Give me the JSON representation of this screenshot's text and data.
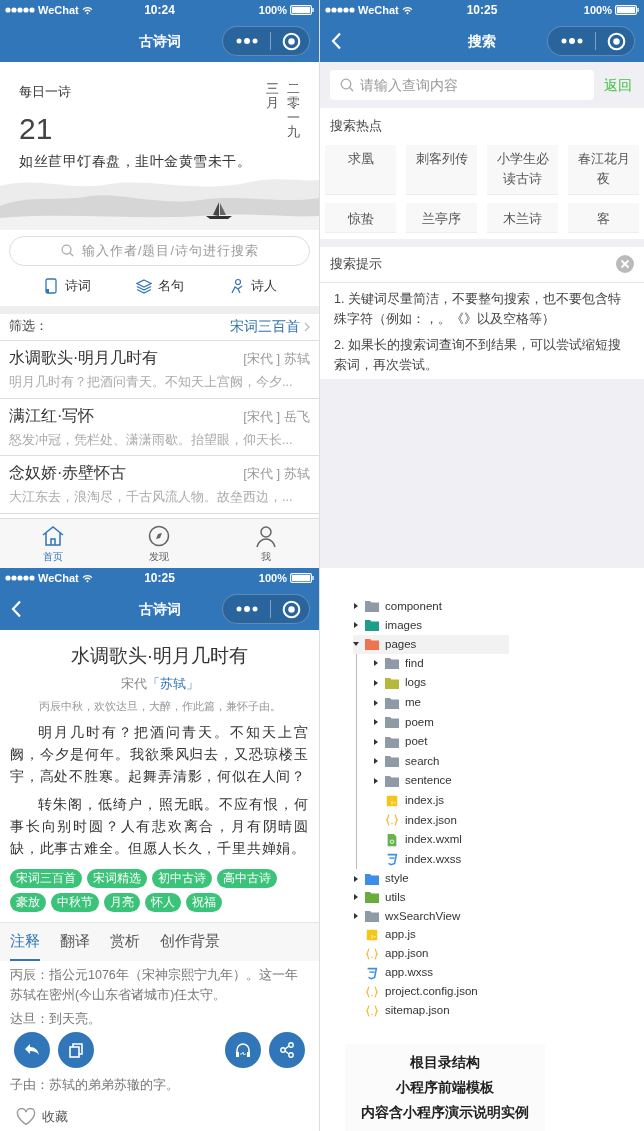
{
  "home_screen": {
    "status_bar": {
      "carrier": "WeChat",
      "time": "10:24",
      "battery": "100%"
    },
    "nav": {
      "title": "古诗词",
      "back": false
    },
    "daily": {
      "label": "每日一诗",
      "day": "21",
      "month": "三月",
      "year": "二零一九",
      "verse": "如丝苣甲饤春盘，韭叶金黄雪未干。"
    },
    "search": {
      "placeholder": "输入作者/题目/诗句进行搜索"
    },
    "categories": [
      {
        "label": "诗词",
        "kind": "poems"
      },
      {
        "label": "名句",
        "kind": "quotes"
      },
      {
        "label": "诗人",
        "kind": "poets"
      }
    ],
    "filter": {
      "label": "筛选：",
      "value": "宋词三百首"
    },
    "poems": [
      {
        "title": "水调歌头·明月几时有",
        "dynasty": "[宋代 ]",
        "author": "苏轼",
        "excerpt": "明月几时有？把酒问青天。不知天上宫阙，今夕..."
      },
      {
        "title": "满江红·写怀",
        "dynasty": "[宋代 ]",
        "author": "岳飞",
        "excerpt": "怒发冲冠，凭栏处、潇潇雨歇。抬望眼，仰天长..."
      },
      {
        "title": "念奴娇·赤壁怀古",
        "dynasty": "[宋代 ]",
        "author": "苏轼",
        "excerpt": "大江东去，浪淘尽，千古风流人物。故垒西边，..."
      }
    ],
    "tab_bar": [
      {
        "label": "首页",
        "kind": "home",
        "selected": true
      },
      {
        "label": "发现",
        "kind": "discover",
        "selected": false
      },
      {
        "label": "我",
        "kind": "me",
        "selected": false
      }
    ]
  },
  "search_screen": {
    "status_bar": {
      "carrier": "WeChat",
      "time": "10:25",
      "battery": "100%"
    },
    "nav": {
      "title": "搜索",
      "back": true
    },
    "search": {
      "placeholder": "请输入查询内容",
      "action": "返回"
    },
    "hot": {
      "title": "搜索热点",
      "items": [
        "求凰",
        "刺客列传",
        "小学生必读古诗",
        "春江花月夜",
        "惊蛰",
        "兰亭序",
        "木兰诗",
        "客"
      ]
    },
    "tips": {
      "title": "搜索提示",
      "items": [
        "1. 关键词尽量简洁，不要整句搜索，也不要包含特殊字符（例如：，。《》以及空格等）",
        "2. 如果长的搜索词查询不到结果，可以尝试缩短搜索词，再次尝试。"
      ]
    }
  },
  "detail_screen": {
    "status_bar": {
      "carrier": "WeChat",
      "time": "10:25",
      "battery": "100%"
    },
    "nav": {
      "title": "古诗词",
      "back": true
    },
    "poem": {
      "title": "水调歌头·明月几时有",
      "dynasty": "宋代",
      "author": "「苏轼」",
      "preface": "丙辰中秋，欢饮达旦，大醉，作此篇，兼怀子由。",
      "paragraphs": [
        "明月几时有？把酒问青天。不知天上宫阙，今夕是何年。我欲乘风归去，又恐琼楼玉宇，高处不胜寒。起舞弄清影，何似在人间？",
        "转朱阁，低绮户，照无眠。不应有恨，何事长向别时圆？人有悲欢离合，月有阴晴圆缺，此事古难全。但愿人长久，千里共婵娟。"
      ],
      "tags": [
        "宋词三百首",
        "宋词精选",
        "初中古诗",
        "高中古诗",
        "豪放",
        "中秋节",
        "月亮",
        "怀人",
        "祝福"
      ]
    },
    "tabs": [
      {
        "label": "注释",
        "selected": true
      },
      {
        "label": "翻译",
        "selected": false
      },
      {
        "label": "赏析",
        "selected": false
      },
      {
        "label": "创作背景",
        "selected": false
      }
    ],
    "notes": [
      "丙辰：指公元1076年（宋神宗熙宁九年）。这一年苏轼在密州(今山东省诸城市)任太守。",
      "达旦：到天亮。",
      "子由：苏轼的弟弟苏辙的字。"
    ],
    "collect": "收藏"
  },
  "file_tree": {
    "items": [
      {
        "name": "component",
        "kind": "folder",
        "color": "#8e9aa6",
        "expanded": false,
        "selected": false
      },
      {
        "name": "images",
        "kind": "folder",
        "color": "#1e9e8a",
        "expanded": false,
        "selected": false
      },
      {
        "name": "pages",
        "kind": "folder",
        "color": "#f0734f",
        "expanded": true,
        "selected": true,
        "children": [
          {
            "name": "find",
            "kind": "folder",
            "color": "#8e9aa6",
            "expanded": false,
            "selected": false
          },
          {
            "name": "logs",
            "kind": "folder",
            "color": "#b5b83a",
            "expanded": false,
            "selected": false
          },
          {
            "name": "me",
            "kind": "folder",
            "color": "#8e9aa6",
            "expanded": false,
            "selected": false
          },
          {
            "name": "poem",
            "kind": "folder",
            "color": "#8e9aa6",
            "expanded": false,
            "selected": false
          },
          {
            "name": "poet",
            "kind": "folder",
            "color": "#8e9aa6",
            "expanded": false,
            "selected": false
          },
          {
            "name": "search",
            "kind": "folder",
            "color": "#8e9aa6",
            "expanded": false,
            "selected": false
          },
          {
            "name": "sentence",
            "kind": "folder",
            "color": "#8e9aa6",
            "expanded": false,
            "selected": false
          },
          {
            "name": "index.js",
            "kind": "js",
            "selected": false
          },
          {
            "name": "index.json",
            "kind": "json",
            "selected": false
          },
          {
            "name": "index.wxml",
            "kind": "wxml",
            "selected": false
          },
          {
            "name": "index.wxss",
            "kind": "wxss",
            "selected": false
          }
        ]
      },
      {
        "name": "style",
        "kind": "folder",
        "color": "#3d8ee8",
        "expanded": false,
        "selected": false
      },
      {
        "name": "utils",
        "kind": "folder",
        "color": "#6aac3c",
        "expanded": false,
        "selected": false
      },
      {
        "name": "wxSearchView",
        "kind": "folder",
        "color": "#8e9aa6",
        "expanded": false,
        "selected": false
      },
      {
        "name": "app.js",
        "kind": "js",
        "selected": false
      },
      {
        "name": "app.json",
        "kind": "json",
        "selected": false
      },
      {
        "name": "app.wxss",
        "kind": "wxss",
        "selected": false
      },
      {
        "name": "project.config.json",
        "kind": "json",
        "selected": false
      },
      {
        "name": "sitemap.json",
        "kind": "json",
        "selected": false
      }
    ],
    "caption": [
      "根目录结构",
      "小程序前端模板",
      "内容含小程序演示说明实例"
    ]
  }
}
